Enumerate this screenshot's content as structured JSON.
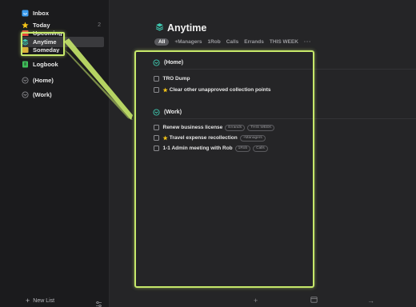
{
  "sidebar": {
    "items": [
      {
        "label": "Inbox",
        "icon": "inbox-icon",
        "count": ""
      },
      {
        "label": "Today",
        "icon": "star-icon",
        "count": "2"
      },
      {
        "label": "Upcoming",
        "icon": "calendar-icon",
        "count": ""
      },
      {
        "label": "Anytime",
        "icon": "stack-icon",
        "count": ""
      },
      {
        "label": "Someday",
        "icon": "box-icon",
        "count": ""
      },
      {
        "label": "Logbook",
        "icon": "logbook-icon",
        "count": ""
      },
      {
        "label": "(Home)",
        "icon": "area-icon",
        "count": ""
      },
      {
        "label": "(Work)",
        "icon": "area-icon",
        "count": ""
      }
    ],
    "new_list_label": "New List"
  },
  "main": {
    "title": "Anytime",
    "filters": [
      "All",
      "+Managers",
      "1Rob",
      "Calls",
      "Errands",
      "THIS WEEK",
      "···"
    ],
    "sections": [
      {
        "heading": "(Home)",
        "todos": [
          {
            "text": "TRO Dump",
            "starred": false,
            "tags": []
          },
          {
            "text": "Clear other unapproved collection points",
            "starred": true,
            "tags": []
          }
        ]
      },
      {
        "heading": "(Work)",
        "todos": [
          {
            "text": "Renew business license",
            "starred": false,
            "tags": [
              "Errands",
              "THIS WEEK"
            ]
          },
          {
            "text": "Travel expense recollection",
            "starred": true,
            "tags": [
              "+Managers"
            ]
          },
          {
            "text": "1-1 Admin meeting with Rob",
            "starred": false,
            "tags": [
              "1Rob",
              "Calls"
            ]
          }
        ]
      }
    ]
  },
  "colors": {
    "accent_highlight": "#c6e86a",
    "star": "#f5c518",
    "inbox": "#3b9cf0",
    "anytime": "#3fc8b0",
    "logbook": "#3fbf5a",
    "upcoming": "#e5463c",
    "someday": "#d9b23a"
  }
}
